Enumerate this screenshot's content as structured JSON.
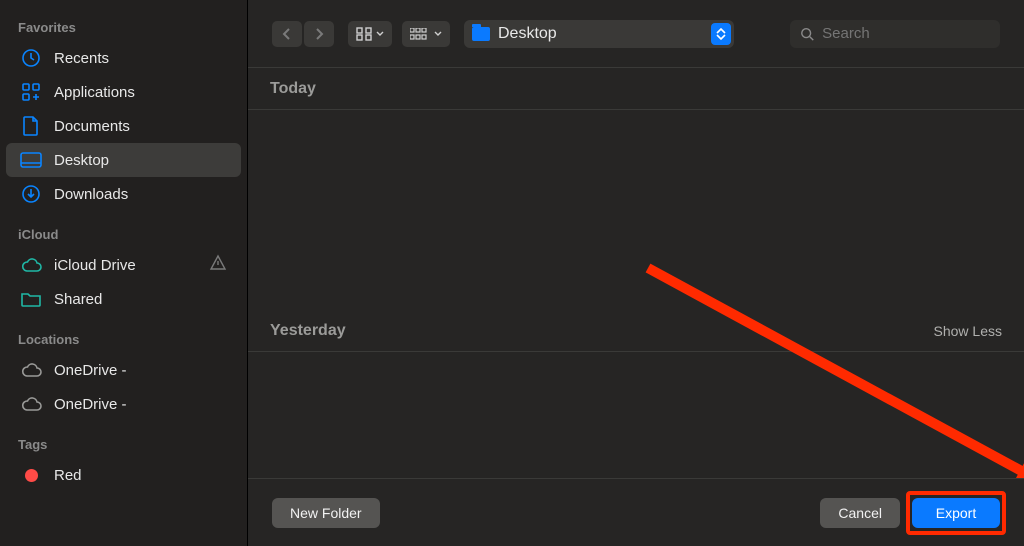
{
  "sidebar": {
    "sections": [
      {
        "label": "Favorites",
        "items": [
          {
            "name": "recents",
            "label": "Recents",
            "icon": "clock-icon"
          },
          {
            "name": "applications",
            "label": "Applications",
            "icon": "apps-icon"
          },
          {
            "name": "documents",
            "label": "Documents",
            "icon": "document-icon"
          },
          {
            "name": "desktop",
            "label": "Desktop",
            "icon": "desktop-icon",
            "selected": true
          },
          {
            "name": "downloads",
            "label": "Downloads",
            "icon": "download-icon"
          }
        ]
      },
      {
        "label": "iCloud",
        "items": [
          {
            "name": "icloud-drive",
            "label": "iCloud Drive",
            "icon": "cloud-icon",
            "trailing_warn": true
          },
          {
            "name": "shared",
            "label": "Shared",
            "icon": "shared-folder-icon"
          }
        ]
      },
      {
        "label": "Locations",
        "items": [
          {
            "name": "onedrive-1",
            "label": "OneDrive -",
            "icon": "cloud-outline-icon"
          },
          {
            "name": "onedrive-2",
            "label": "OneDrive -",
            "icon": "cloud-outline-icon"
          }
        ]
      },
      {
        "label": "Tags",
        "items": [
          {
            "name": "tag-red",
            "label": "Red",
            "icon": "tag-dot",
            "dot_color": "#ff4b47"
          }
        ]
      }
    ]
  },
  "toolbar": {
    "location_label": "Desktop",
    "search_placeholder": "Search"
  },
  "content": {
    "groups": [
      {
        "label": "Today",
        "show_less": false
      },
      {
        "label": "Yesterday",
        "show_less": true,
        "show_less_label": "Show Less"
      }
    ]
  },
  "footer": {
    "new_folder_label": "New Folder",
    "cancel_label": "Cancel",
    "export_label": "Export"
  },
  "colors": {
    "accent": "#0a7aff",
    "annotation": "#ff2a00"
  }
}
